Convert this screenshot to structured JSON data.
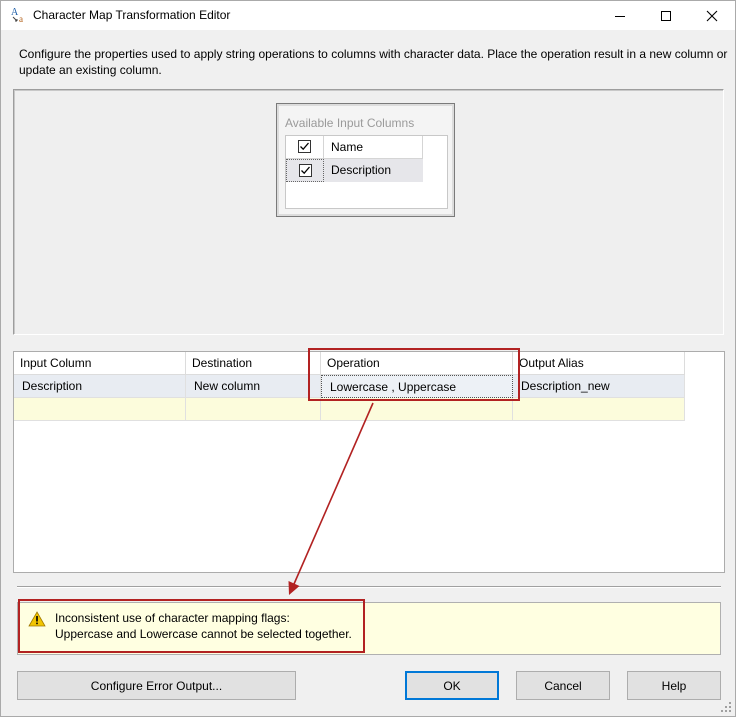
{
  "window": {
    "title": "Character Map Transformation Editor",
    "icon": "character-map-icon"
  },
  "description": "Configure the properties used to apply string operations to columns with character data. Place the operation result in a new column or update an existing column.",
  "input_columns": {
    "title": "Available Input Columns",
    "items": [
      {
        "label": "Name",
        "checked": true
      },
      {
        "label": "Description",
        "checked": true
      }
    ]
  },
  "grid": {
    "headers": [
      "Input Column",
      "Destination",
      "Operation",
      "Output Alias"
    ],
    "rows": [
      [
        "Description",
        "New column",
        "Lowercase , Uppercase",
        "Description_new"
      ]
    ]
  },
  "message": {
    "icon": "warning-icon",
    "line1": "Inconsistent use of character mapping flags:",
    "line2": "Uppercase and Lowercase cannot be selected together."
  },
  "buttons": {
    "configure_error_output": "Configure Error Output...",
    "ok": "OK",
    "cancel": "Cancel",
    "help": "Help"
  },
  "colors": {
    "highlight": "#b22222",
    "message_background": "#ffffe1",
    "default_button_border": "#0078d7"
  }
}
